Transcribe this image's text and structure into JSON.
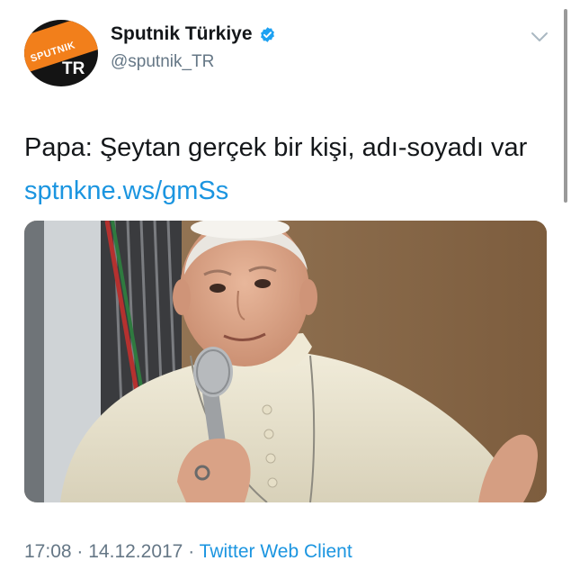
{
  "author": {
    "display_name": "Sputnik Türkiye",
    "handle": "@sputnik_TR",
    "verified": true,
    "avatar": {
      "logo_text": "SPUTNIK",
      "badge_text": "TR",
      "brand_color": "#f27f1b"
    }
  },
  "tweet": {
    "text": "Papa: Şeytan gerçek bir kişi, adı-soyadı var",
    "link": "sptnkne.ws/gmSs"
  },
  "media": {
    "icon": "photo-pope-holding-microphone"
  },
  "meta": {
    "time": "17:08",
    "separator": "·",
    "date": "14.12.2017",
    "client": "Twitter Web Client"
  },
  "colors": {
    "link": "#1b95e0",
    "secondary_text": "#657786",
    "primary_text": "#14171a"
  },
  "icons": {
    "verified": "verified-badge-icon",
    "menu": "chevron-down-icon"
  }
}
